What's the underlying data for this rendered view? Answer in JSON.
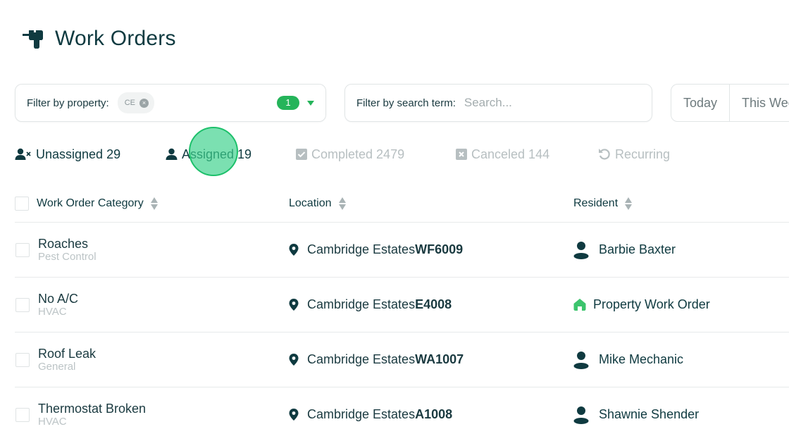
{
  "page": {
    "title": "Work Orders",
    "title_icon": "drill-icon"
  },
  "filters": {
    "property": {
      "label": "Filter by property:",
      "chip": "CE",
      "count": "1"
    },
    "search": {
      "label": "Filter by search term:",
      "placeholder": "Search...",
      "value": ""
    },
    "date_tabs": [
      "Today",
      "This Week"
    ]
  },
  "status_tabs": [
    {
      "label": "Unassigned 29",
      "icon": "user-x-icon",
      "state": "active"
    },
    {
      "label": "Assigned 19",
      "icon": "user-icon",
      "state": "active"
    },
    {
      "label": "Completed 2479",
      "icon": "check-square-icon",
      "state": "muted"
    },
    {
      "label": "Canceled 144",
      "icon": "x-square-icon",
      "state": "muted"
    },
    {
      "label": "Recurring",
      "icon": "undo-icon",
      "state": "muted"
    }
  ],
  "table": {
    "columns": [
      "Work Order Category",
      "Location",
      "Resident"
    ],
    "rows": [
      {
        "category": "Roaches",
        "subcategory": "Pest Control",
        "property": "Cambridge Estates",
        "unit": "WF6009",
        "resident": "Barbie Baxter",
        "resident_type": "person"
      },
      {
        "category": "No A/C",
        "subcategory": "HVAC",
        "property": "Cambridge Estates",
        "unit": "E4008",
        "resident": "Property Work Order",
        "resident_type": "property"
      },
      {
        "category": "Roof Leak",
        "subcategory": "General",
        "property": "Cambridge Estates",
        "unit": "WA1007",
        "resident": "Mike Mechanic",
        "resident_type": "person"
      },
      {
        "category": "Thermostat Broken",
        "subcategory": "HVAC",
        "property": "Cambridge Estates",
        "unit": "A1008",
        "resident": "Shawnie Shender",
        "resident_type": "person"
      }
    ]
  },
  "colors": {
    "primary_text": "#0f3a40",
    "accent_green": "#25b45a",
    "muted": "#b7bfc1"
  }
}
